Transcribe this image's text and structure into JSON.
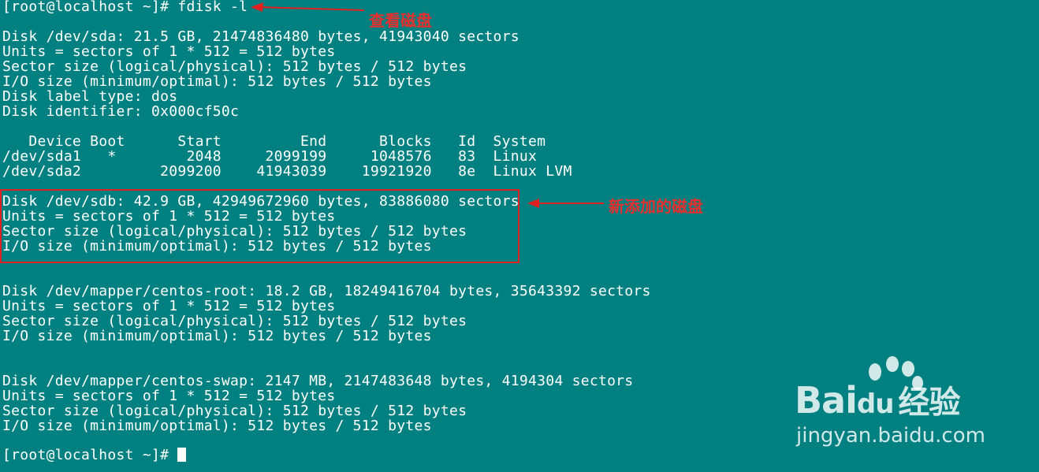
{
  "terminal": {
    "background": "#008080",
    "lines": [
      "[root@localhost ~]# fdisk -l",
      "",
      "Disk /dev/sda: 21.5 GB, 21474836480 bytes, 41943040 sectors",
      "Units = sectors of 1 * 512 = 512 bytes",
      "Sector size (logical/physical): 512 bytes / 512 bytes",
      "I/O size (minimum/optimal): 512 bytes / 512 bytes",
      "Disk label type: dos",
      "Disk identifier: 0x000cf50c",
      "",
      "   Device Boot      Start         End      Blocks   Id  System",
      "/dev/sda1   *        2048     2099199     1048576   83  Linux",
      "/dev/sda2         2099200    41943039    19921920   8e  Linux LVM",
      "",
      "Disk /dev/sdb: 42.9 GB, 42949672960 bytes, 83886080 sectors",
      "Units = sectors of 1 * 512 = 512 bytes",
      "Sector size (logical/physical): 512 bytes / 512 bytes",
      "I/O size (minimum/optimal): 512 bytes / 512 bytes",
      "",
      "",
      "Disk /dev/mapper/centos-root: 18.2 GB, 18249416704 bytes, 35643392 sectors",
      "Units = sectors of 1 * 512 = 512 bytes",
      "Sector size (logical/physical): 512 bytes / 512 bytes",
      "I/O size (minimum/optimal): 512 bytes / 512 bytes",
      "",
      "",
      "Disk /dev/mapper/centos-swap: 2147 MB, 2147483648 bytes, 4194304 sectors",
      "Units = sectors of 1 * 512 = 512 bytes",
      "Sector size (logical/physical): 512 bytes / 512 bytes",
      "I/O size (minimum/optimal): 512 bytes / 512 bytes",
      "",
      "[root@localhost ~]# "
    ]
  },
  "annotations": {
    "view_disk": "查看磁盘",
    "new_disk": "新添加的磁盘",
    "color": "#e53030"
  },
  "watermark": {
    "brand": "Bai",
    "brand_tail": "du",
    "suffix": "经验",
    "url": "jingyan.baidu.com"
  }
}
